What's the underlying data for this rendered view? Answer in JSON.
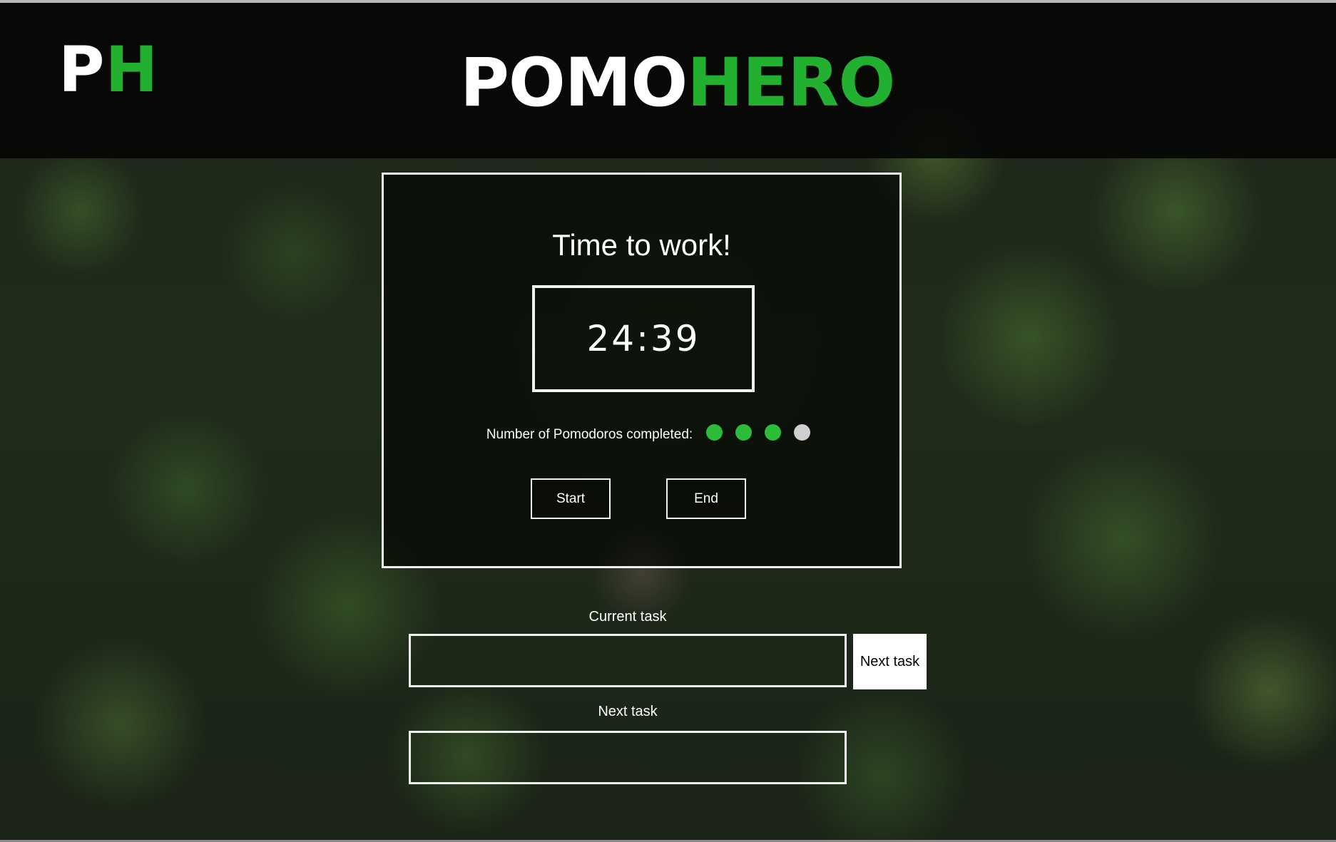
{
  "header": {
    "logo_letter_1": "P",
    "logo_letter_2": "H",
    "title_part_1": "POMO",
    "title_part_2": "HERO"
  },
  "timer": {
    "heading": "Time to work!",
    "time": "24:39",
    "pomodoros_label": "Number of Pomodoros completed:",
    "pomodoros_completed": 3,
    "pomodoros_total": 4,
    "start_label": "Start",
    "end_label": "End"
  },
  "tasks": {
    "current_label": "Current task",
    "current_value": "",
    "next_task_button": "Next task",
    "next_label": "Next task",
    "next_value": ""
  },
  "colors": {
    "accent_green": "#22b030",
    "dot_done": "#2dbc3a",
    "dot_pending": "#cfcfcf",
    "panel_border": "#f2f2f2"
  }
}
